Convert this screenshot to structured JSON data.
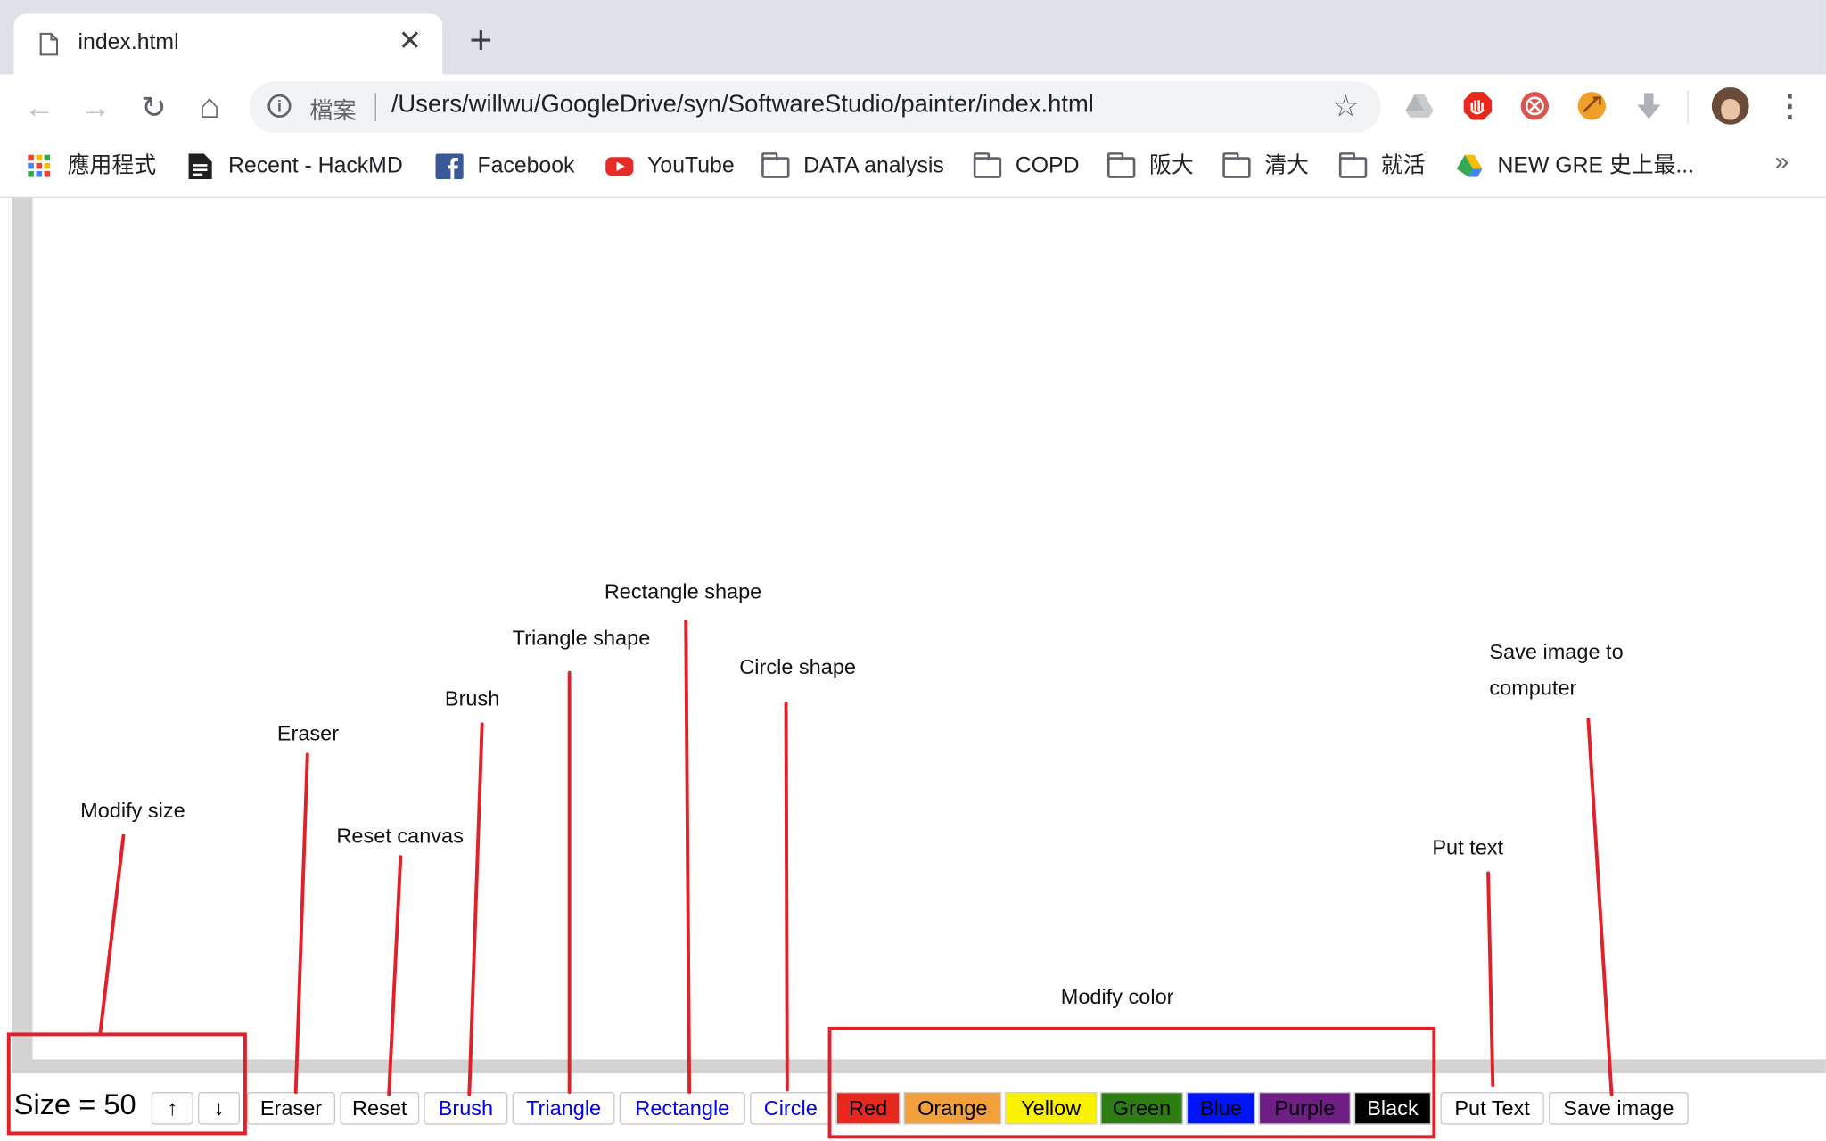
{
  "tab": {
    "title": "index.html",
    "close": "✕",
    "new_tab": "+",
    "icon": "file-icon"
  },
  "nav": {
    "back": "←",
    "forward": "→",
    "reload": "↻",
    "home": "⌂"
  },
  "omnibox": {
    "info_icon": "i",
    "scheme_label": "檔案",
    "url": "/Users/willwu/GoogleDrive/syn/SoftwareStudio/painter/index.html",
    "star": "☆"
  },
  "extensions": [
    "google-drive-icon",
    "adblock-icon",
    "extension-red-icon",
    "extension-orange-icon",
    "download-arrow-icon"
  ],
  "menu": "⋮",
  "bookmarks": [
    {
      "label": "應用程式",
      "icon": "apps-grid-icon"
    },
    {
      "label": "Recent - HackMD",
      "icon": "hackmd-doc-icon"
    },
    {
      "label": "Facebook",
      "icon": "facebook-icon"
    },
    {
      "label": "YouTube",
      "icon": "youtube-icon"
    },
    {
      "label": "DATA analysis",
      "icon": "folder-icon"
    },
    {
      "label": "COPD",
      "icon": "folder-icon"
    },
    {
      "label": "阪大",
      "icon": "folder-icon"
    },
    {
      "label": "清大",
      "icon": "folder-icon"
    },
    {
      "label": "就活",
      "icon": "folder-icon"
    },
    {
      "label": "NEW GRE 史上最...",
      "icon": "google-drive-icon"
    }
  ],
  "bookmarks_more": "»",
  "painter": {
    "size_label": "Size = 50",
    "size_up": "↑",
    "size_down": "↓",
    "tools": {
      "eraser": "Eraser",
      "reset": "Reset",
      "brush": "Brush",
      "triangle": "Triangle",
      "rectangle": "Rectangle",
      "circle": "Circle"
    },
    "colors": [
      {
        "label": "Red",
        "hex": "#e8271d"
      },
      {
        "label": "Orange",
        "hex": "#f2a03a"
      },
      {
        "label": "Yellow",
        "hex": "#fbf200"
      },
      {
        "label": "Green",
        "hex": "#2e7d13"
      },
      {
        "label": "Blue",
        "hex": "#0015f5"
      },
      {
        "label": "Purple",
        "hex": "#6e1e84"
      },
      {
        "label": "Black",
        "hex": "#000000"
      }
    ],
    "put_text": "Put Text",
    "save_image": "Save image"
  },
  "annotations": {
    "modify_size": "Modify size",
    "eraser": "Eraser",
    "reset_canvas": "Reset canvas",
    "brush": "Brush",
    "triangle_shape": "Triangle shape",
    "rectangle_shape": "Rectangle shape",
    "circle_shape": "Circle shape",
    "modify_color": "Modify color",
    "put_text": "Put text",
    "save_image_line1": "Save image to",
    "save_image_line2": "computer"
  },
  "annotation_color": "#e2202a"
}
